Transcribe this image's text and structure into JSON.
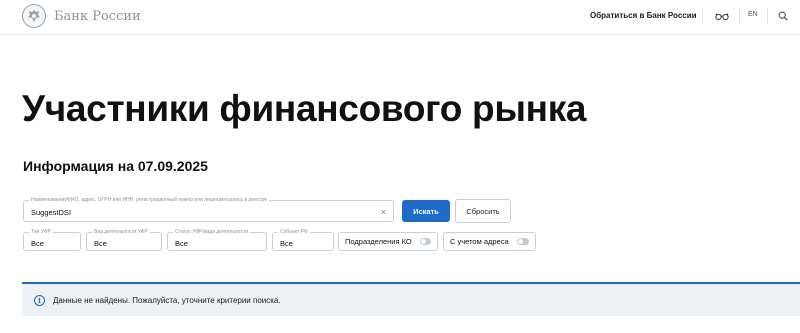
{
  "header": {
    "logo_text": "Банк России",
    "contact_link": "Обратиться в Банк России",
    "lang": "EN",
    "icons": [
      "emblem-icon",
      "eye-icon",
      "search-icon"
    ]
  },
  "page": {
    "title": "Участники финансового рынка",
    "info_heading": "Информация на 07.09.2025"
  },
  "search": {
    "label": "Наименование/ФИО, адрес, ОГРН или ИНН, регистрационный номер или лицензия/запись в реестре",
    "value": "SuggestDSI",
    "clear_icon": "×",
    "submit_label": "Искать",
    "reset_label": "Сбросить"
  },
  "filters": [
    {
      "label": "Тип УФР",
      "value": "Все"
    },
    {
      "label": "Вид деятельности УФР",
      "value": "Все"
    },
    {
      "label": "Статус УФР/вида деятельности",
      "value": "Все"
    },
    {
      "label": "Субъект РФ",
      "value": "Все"
    }
  ],
  "toggles": [
    {
      "label": "Подразделения КО",
      "on": false
    },
    {
      "label": "С учетом адреса",
      "on": false
    }
  ],
  "alert": {
    "icon": "info-icon",
    "text": "Данные не найдены. Пожалуйста, уточните критерии поиска."
  },
  "colors": {
    "accent": "#1e6cc8",
    "alert_bg": "#eef1f3",
    "border": "#c9cfd4",
    "logo_grey": "#8a939b"
  }
}
